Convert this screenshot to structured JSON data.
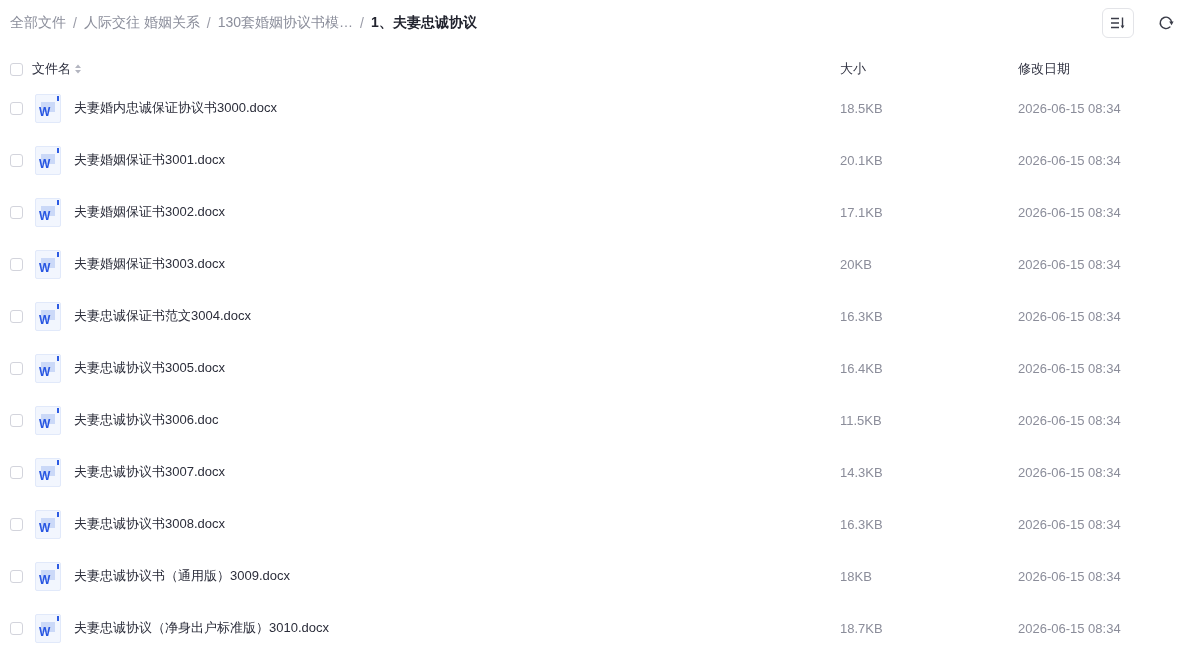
{
  "breadcrumb": {
    "items": [
      {
        "label": "全部文件",
        "current": false
      },
      {
        "separator": "/",
        "label": "人际交往 婚姻关系",
        "current": false
      },
      {
        "separator": "/",
        "label": "130套婚姻协议书模…",
        "current": false
      },
      {
        "separator": "/",
        "label": "1、夫妻忠诚协议",
        "current": true
      }
    ]
  },
  "table": {
    "select_all": {
      "checked": false
    },
    "columns": [
      {
        "label": "文件名",
        "sortable": true
      },
      {
        "label": "大小",
        "sortable": false
      },
      {
        "label": "修改日期",
        "sortable": false
      }
    ],
    "rows": [
      {
        "checked": false,
        "icon_label": "W",
        "name": "夫妻婚内忠诚保证协议书3000.docx",
        "size": "18.5KB",
        "modified": "2026-06-15 08:34"
      },
      {
        "checked": false,
        "icon_label": "W",
        "name": "夫妻婚姻保证书3001.docx",
        "size": "20.1KB",
        "modified": "2026-06-15 08:34"
      },
      {
        "checked": false,
        "icon_label": "W",
        "name": "夫妻婚姻保证书3002.docx",
        "size": "17.1KB",
        "modified": "2026-06-15 08:34"
      },
      {
        "checked": false,
        "icon_label": "W",
        "name": "夫妻婚姻保证书3003.docx",
        "size": "20KB",
        "modified": "2026-06-15 08:34"
      },
      {
        "checked": false,
        "icon_label": "W",
        "name": "夫妻忠诚保证书范文3004.docx",
        "size": "16.3KB",
        "modified": "2026-06-15 08:34"
      },
      {
        "checked": false,
        "icon_label": "W",
        "name": "夫妻忠诚协议书3005.docx",
        "size": "16.4KB",
        "modified": "2026-06-15 08:34"
      },
      {
        "checked": false,
        "icon_label": "W",
        "name": "夫妻忠诚协议书3006.doc",
        "size": "11.5KB",
        "modified": "2026-06-15 08:34"
      },
      {
        "checked": false,
        "icon_label": "W",
        "name": "夫妻忠诚协议书3007.docx",
        "size": "14.3KB",
        "modified": "2026-06-15 08:34"
      },
      {
        "checked": false,
        "icon_label": "W",
        "name": "夫妻忠诚协议书3008.docx",
        "size": "16.3KB",
        "modified": "2026-06-15 08:34"
      },
      {
        "checked": false,
        "icon_label": "W",
        "name": "夫妻忠诚协议书（通用版）3009.docx",
        "size": "18KB",
        "modified": "2026-06-15 08:34"
      },
      {
        "checked": false,
        "icon_label": "W",
        "name": "夫妻忠诚协议（净身出户标准版）3010.docx",
        "size": "18.7KB",
        "modified": "2026-06-15 08:34"
      }
    ]
  }
}
